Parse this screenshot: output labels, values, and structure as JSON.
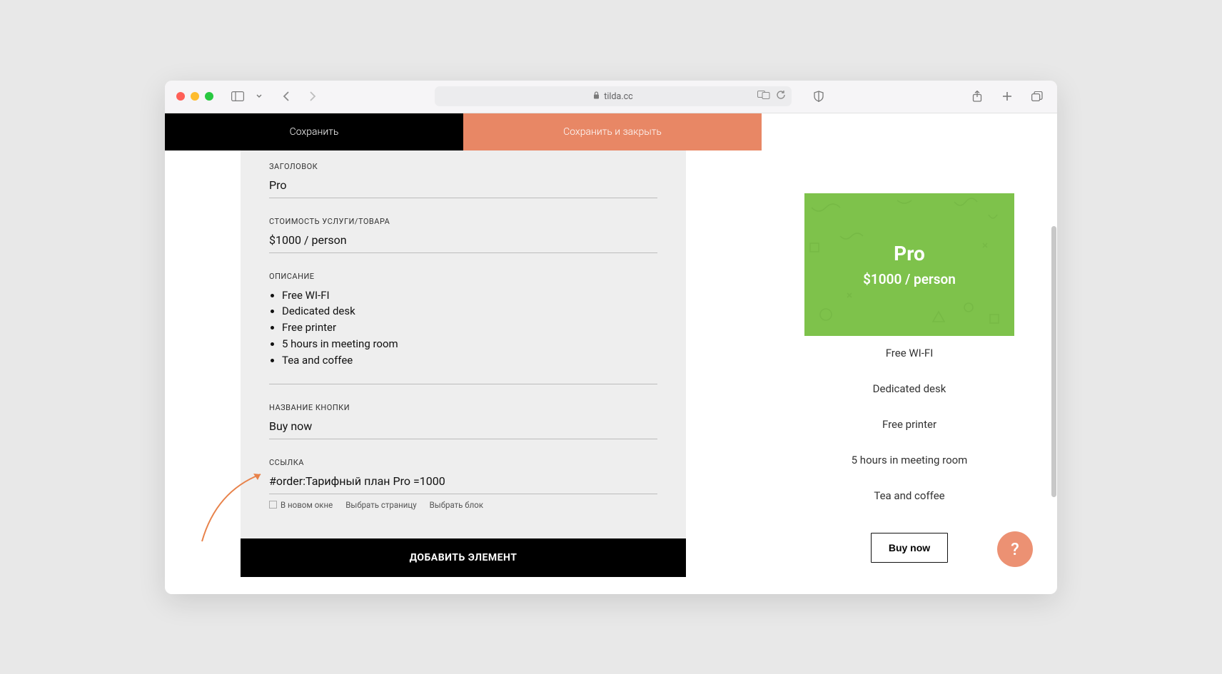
{
  "browser": {
    "url_host": "tilda.cc"
  },
  "editor": {
    "save_label": "Сохранить",
    "save_close_label": "Сохранить и закрыть",
    "add_element_label": "ДОБАВИТЬ ЭЛЕМЕНТ",
    "fields": {
      "title_label": "ЗАГОЛОВОК",
      "title_value": "Pro",
      "price_label": "СТОИМОСТЬ УСЛУГИ/ТОВАРА",
      "price_value": "$1000 / person",
      "desc_label": "ОПИСАНИЕ",
      "desc_items": [
        "Free WI-FI",
        "Dedicated desk",
        "Free printer",
        "5 hours in meeting room",
        "Tea and coffee"
      ],
      "btn_label": "НАЗВАНИЕ КНОПКИ",
      "btn_value": "Buy now",
      "link_label": "ССЫЛКА",
      "link_value": "#order:Тарифный план Pro =1000",
      "new_window_label": "В новом окне",
      "select_page_label": "Выбрать страницу",
      "select_block_label": "Выбрать блок"
    }
  },
  "preview": {
    "title": "Pro",
    "price": "$1000 / person",
    "features": [
      "Free WI-FI",
      "Dedicated desk",
      "Free printer",
      "5 hours in meeting room",
      "Tea and coffee"
    ],
    "button": "Buy now"
  },
  "help_label": "?"
}
